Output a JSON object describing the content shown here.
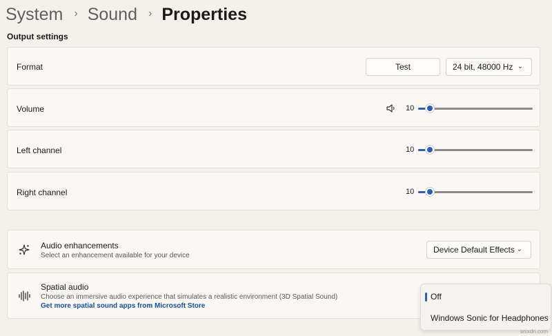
{
  "breadcrumb": {
    "items": [
      "System",
      "Sound",
      "Properties"
    ],
    "separator": "›"
  },
  "output_settings": {
    "title": "Output settings"
  },
  "format": {
    "label": "Format",
    "test_button": "Test",
    "format_value": "24 bit, 48000 Hz",
    "chevron": "⌄"
  },
  "volume": {
    "label": "Volume",
    "value": "10",
    "level": 0.1,
    "icon": "speaker-icon"
  },
  "left_channel": {
    "label": "Left channel",
    "value": "10",
    "level": 0.1
  },
  "right_channel": {
    "label": "Right channel",
    "value": "10",
    "level": 0.1
  },
  "audio_enhancements": {
    "title": "Audio enhancements",
    "subtitle": "Select an enhancement available for your device",
    "value": "Device Default Effects",
    "chevron": "⌄",
    "icon": "sparkle-icon"
  },
  "spatial_audio": {
    "title": "Spatial audio",
    "subtitle": "Choose an immersive audio experience that simulates a realistic environment (3D Spatial Sound)",
    "link": "Get more spatial sound apps from Microsoft Store",
    "icon": "sound-wave-icon",
    "options": [
      "Off",
      "Windows Sonic for Headphones"
    ],
    "selected": "Off"
  },
  "watermark": "wsxdn.com",
  "colors": {
    "accent": "#2a5fb5",
    "background": "#f4f1ec",
    "card": "#faf8f5",
    "link": "#1a4f9c"
  }
}
